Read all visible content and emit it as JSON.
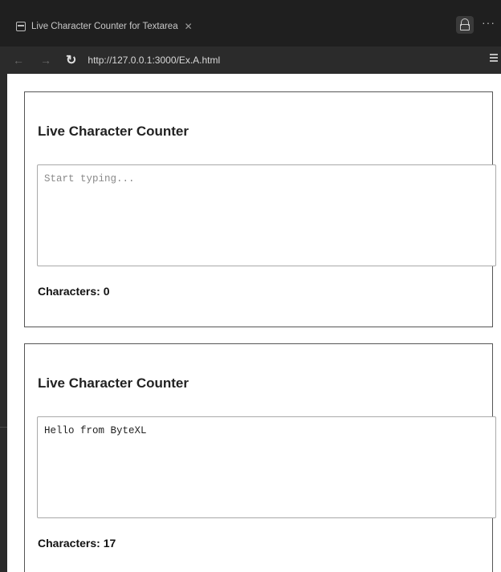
{
  "browser": {
    "tab_title": "Live Character Counter for Textarea",
    "tab_close_icon": "close-icon",
    "url": "http://127.0.0.1:3000/Ex.A.html",
    "more_label": "···"
  },
  "cards": [
    {
      "title": "Live Character Counter",
      "placeholder": "Start typing...",
      "value": "",
      "counter": "Characters: 0"
    },
    {
      "title": "Live Character Counter",
      "placeholder": "",
      "value": "Hello from ByteXL",
      "counter": "Characters: 17"
    }
  ]
}
